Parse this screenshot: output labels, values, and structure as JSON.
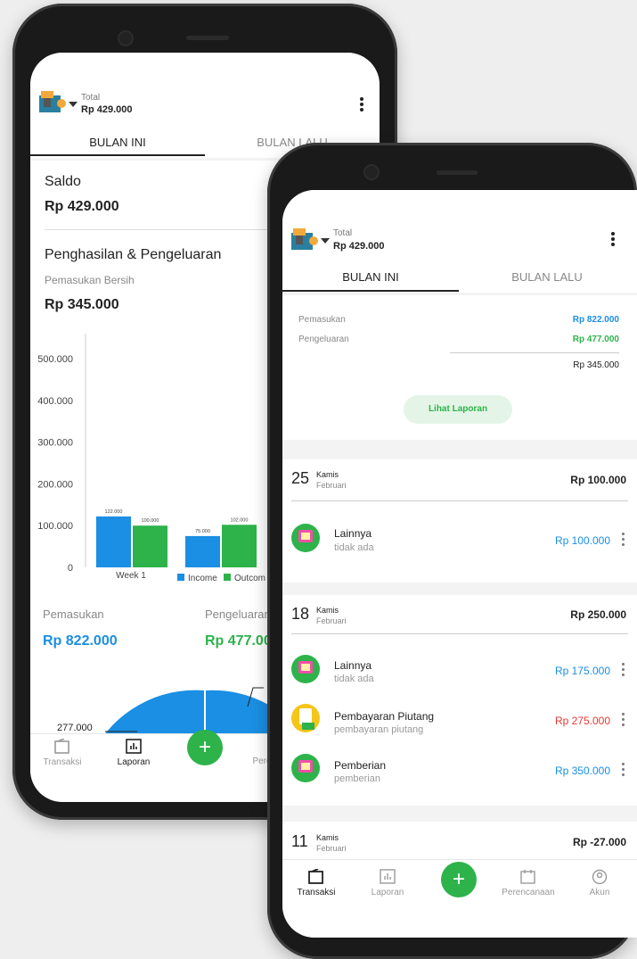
{
  "app": {
    "total_label": "Total",
    "total_value": "Rp 429.000",
    "tabs": [
      "BULAN INI",
      "BULAN LALU"
    ]
  },
  "report_screen": {
    "saldo_label": "Saldo",
    "saldo_value": "Rp 429.000",
    "section_title": "Penghasilan & Pengeluaran",
    "net_label": "Pemasukan Bersih",
    "net_value": "Rp 345.000",
    "pemasukan_label": "Pemasukan",
    "pemasukan_value": "Rp 822.000",
    "pengeluaran_label": "Pengeluaran",
    "pengeluaran_value": "Rp 477.00",
    "pie_label": "277.000"
  },
  "chart_data": {
    "type": "bar",
    "categories": [
      "Week 1",
      ""
    ],
    "series": [
      {
        "name": "Income",
        "values": [
          122000,
          75000
        ],
        "labels": [
          "122.000",
          "75.000"
        ],
        "color": "#1a8fe3"
      },
      {
        "name": "Outcom",
        "values": [
          100000,
          102000
        ],
        "labels": [
          "100.000",
          "102.000"
        ],
        "color": "#2db34a"
      }
    ],
    "y_ticks": [
      "0",
      "100.000",
      "200.000",
      "300.000",
      "400.000",
      "500.000"
    ],
    "ylim": [
      0,
      500000
    ],
    "legend_position": "bottom-right"
  },
  "transactions_screen": {
    "summary": {
      "pemasukan_label": "Pemasukan",
      "pemasukan_value": "Rp 822.000",
      "pengeluaran_label": "Pengeluaran",
      "pengeluaran_value": "Rp 477.000",
      "net_value": "Rp 345.000",
      "report_button": "Lihat Laporan"
    },
    "days": [
      {
        "day": "25",
        "weekday": "Kamis",
        "month": "Februari",
        "total": "Rp 100.000",
        "items": [
          {
            "title": "Lainnya",
            "subtitle": "tidak ada",
            "amount": "Rp 100.000",
            "amount_color": "#1a8fe3",
            "icon": "monitor-icon"
          }
        ]
      },
      {
        "day": "18",
        "weekday": "Kamis",
        "month": "Februari",
        "total": "Rp 250.000",
        "items": [
          {
            "title": "Lainnya",
            "subtitle": "tidak ada",
            "amount": "Rp 175.000",
            "amount_color": "#1a8fe3",
            "icon": "monitor-icon"
          },
          {
            "title": "Pembayaran Piutang",
            "subtitle": "pembayaran piutang",
            "amount": "Rp 275.000",
            "amount_color": "#e53935",
            "icon": "receipt-icon"
          },
          {
            "title": "Pemberian",
            "subtitle": "pemberian",
            "amount": "Rp 350.000",
            "amount_color": "#1a8fe3",
            "icon": "monitor-icon"
          }
        ]
      },
      {
        "day": "11",
        "weekday": "Kamis",
        "month": "Februari",
        "total": "Rp -27.000",
        "items": []
      }
    ]
  },
  "nav_back": [
    "Transaksi",
    "Laporan",
    "Pere"
  ],
  "nav_front": [
    "Transaksi",
    "Laporan",
    "Perencanaan",
    "Akun"
  ],
  "fab_label": "+"
}
